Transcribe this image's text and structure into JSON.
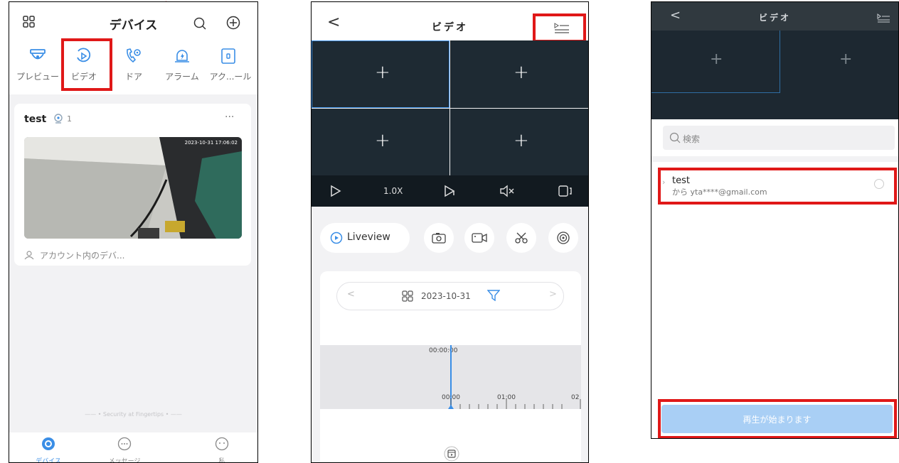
{
  "phone1": {
    "title": "デバイス",
    "shortcuts": [
      {
        "label": "プレビュー",
        "icon": "camera-dome-icon"
      },
      {
        "label": "ビデオ",
        "icon": "video-playback-icon"
      },
      {
        "label": "ドア",
        "icon": "door-phone-icon"
      },
      {
        "label": "アラーム",
        "icon": "alarm-bell-icon"
      },
      {
        "label": "アク...ール",
        "icon": "access-control-icon"
      }
    ],
    "device_name": "test",
    "device_count": "1",
    "more": "···",
    "thumb_timestamp": "2023-10-31 17:06:02",
    "account_devices": "アカウント内のデバ...",
    "slogan": "—— • Security at Fingertips • ——",
    "tabs": [
      {
        "label": "デバイス",
        "icon": "device-tab-icon"
      },
      {
        "label": "メッセージ",
        "icon": "message-tab-icon"
      },
      {
        "label": "私",
        "icon": "profile-tab-icon"
      }
    ],
    "accent": "#3a8ee6"
  },
  "phone2": {
    "title": "ビデオ",
    "grid_plus": "+",
    "speed": "1.0X",
    "liveview": "Liveview",
    "date": "2023-10-31",
    "time_cursor": "00:00:00",
    "ticks": [
      "00:00",
      "01:00",
      "02"
    ],
    "nav_prev": "<",
    "nav_next": ">"
  },
  "phone3": {
    "title": "ビデオ",
    "search_placeholder": "検索",
    "device_name": "test",
    "device_from": "から yta****@gmail.com",
    "play_button": "再生が始まります",
    "play_color": "#a9cff5"
  }
}
